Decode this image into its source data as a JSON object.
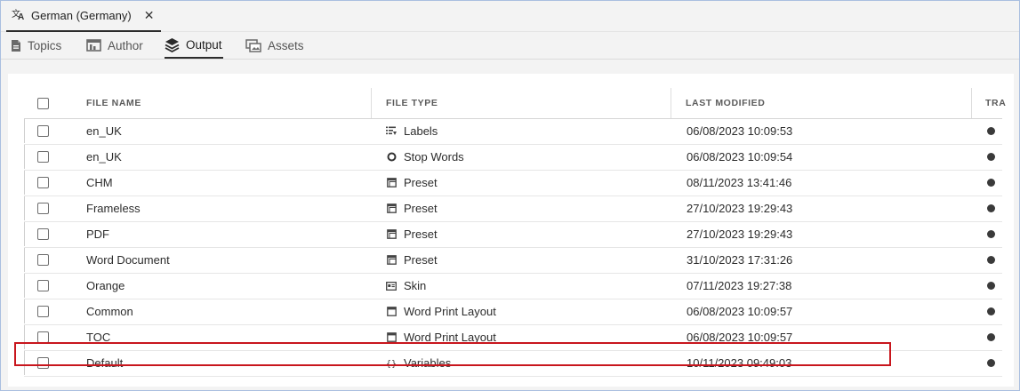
{
  "doc_tab": {
    "label": "German (Germany)",
    "close": "✕",
    "icon": "translate-icon"
  },
  "subtabs": [
    {
      "label": "Topics",
      "icon": "document-icon"
    },
    {
      "label": "Author",
      "icon": "author-icon"
    },
    {
      "label": "Output",
      "icon": "layers-icon",
      "active": true
    },
    {
      "label": "Assets",
      "icon": "assets-icon"
    }
  ],
  "table": {
    "columns": [
      "FILE NAME",
      "FILE TYPE",
      "LAST MODIFIED",
      "TRA"
    ],
    "rows": [
      {
        "name": "en_UK",
        "type": "Labels",
        "type_icon": "labels-icon",
        "modified": "06/08/2023 10:09:53"
      },
      {
        "name": "en_UK",
        "type": "Stop Words",
        "type_icon": "stop-words-icon",
        "modified": "06/08/2023 10:09:54"
      },
      {
        "name": "CHM",
        "type": "Preset",
        "type_icon": "preset-icon",
        "modified": "08/11/2023 13:41:46"
      },
      {
        "name": "Frameless",
        "type": "Preset",
        "type_icon": "preset-icon",
        "modified": "27/10/2023 19:29:43"
      },
      {
        "name": "PDF",
        "type": "Preset",
        "type_icon": "preset-icon",
        "modified": "27/10/2023 19:29:43"
      },
      {
        "name": "Word Document",
        "type": "Preset",
        "type_icon": "preset-icon",
        "modified": "31/10/2023 17:31:26"
      },
      {
        "name": "Orange",
        "type": "Skin",
        "type_icon": "skin-icon",
        "modified": "07/11/2023 19:27:38"
      },
      {
        "name": "Common",
        "type": "Word Print Layout",
        "type_icon": "print-layout-icon",
        "modified": "06/08/2023 10:09:57"
      },
      {
        "name": "TOC",
        "type": "Word Print Layout",
        "type_icon": "print-layout-icon",
        "modified": "06/08/2023 10:09:57"
      },
      {
        "name": "Default",
        "type": "Variables",
        "type_icon": "variables-icon",
        "modified": "10/11/2023 09:49:03",
        "highlighted": true
      }
    ]
  },
  "colors": {
    "highlight": "#c8161d",
    "status_dot": "#3a3a3a"
  }
}
